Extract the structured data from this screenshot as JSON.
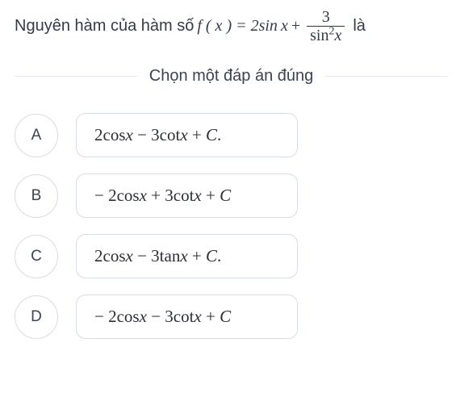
{
  "question": {
    "prefix": "Nguyên hàm của hàm số ",
    "func_left": "f ( x ) = 2sin",
    "func_var1": "x",
    "plus": " + ",
    "frac_num": "3",
    "frac_den_sin": "sin",
    "frac_den_x": "x",
    "trail": "là"
  },
  "instruction": "Chọn một đáp án đúng",
  "options": [
    {
      "letter": "A",
      "expr_pre": "2cos",
      "x1": "x",
      "mid": " − 3cot",
      "x2": "x",
      "post": " + ",
      "C": "C",
      "dot": "."
    },
    {
      "letter": "B",
      "expr_pre": " − 2cos",
      "x1": "x",
      "mid": " + 3cot",
      "x2": "x",
      "post": " + ",
      "C": "C",
      "dot": ""
    },
    {
      "letter": "C",
      "expr_pre": "2cos",
      "x1": "x",
      "mid": " − 3tan",
      "x2": "x",
      "post": " + ",
      "C": "C",
      "dot": "."
    },
    {
      "letter": "D",
      "expr_pre": " − 2cos",
      "x1": "x",
      "mid": " − 3cot",
      "x2": "x",
      "post": " + ",
      "C": "C",
      "dot": ""
    }
  ]
}
